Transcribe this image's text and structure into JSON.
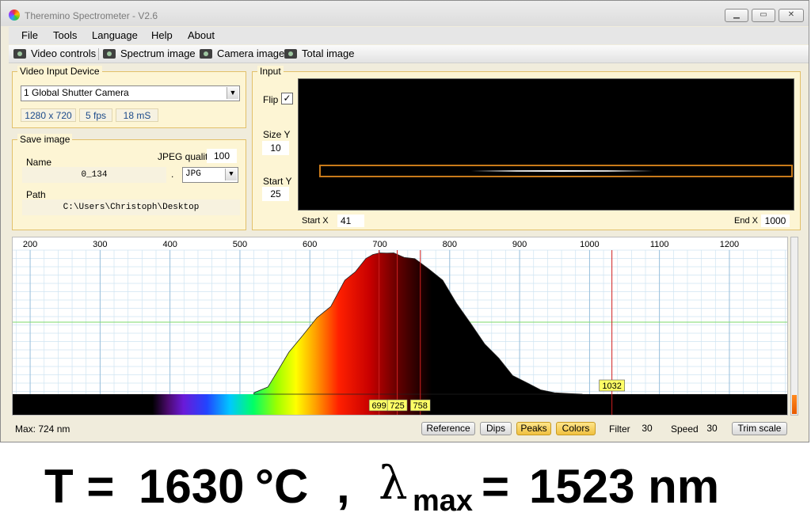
{
  "window": {
    "title": "Theremino Spectrometer - V2.6"
  },
  "menu": [
    "File",
    "Tools",
    "Language",
    "Help",
    "About"
  ],
  "toolbar": {
    "video_controls": "Video controls",
    "spectrum_image": "Spectrum image",
    "camera_image": "Camera image",
    "total_image": "Total image"
  },
  "video_input": {
    "legend": "Video Input Device",
    "device": "1 Global Shutter Camera",
    "resolution": "1280 x 720",
    "fps": "5 fps",
    "exposure": "18 mS"
  },
  "save_image": {
    "legend": "Save image",
    "name_label": "Name",
    "name_value": "0_134",
    "dot": ".",
    "jpeg_quality_label": "JPEG quality",
    "jpeg_quality_value": "100",
    "format": "JPG",
    "path_label": "Path",
    "path_value": "C:\\Users\\Christoph\\Desktop"
  },
  "input": {
    "legend": "Input",
    "flip_label": "Flip",
    "flip_checked": true,
    "size_y_label": "Size Y",
    "size_y_value": "10",
    "start_y_label": "Start Y",
    "start_y_value": "25",
    "start_x_label": "Start X",
    "start_x_value": "41",
    "end_x_label": "End X",
    "end_x_value": "1000"
  },
  "chart_data": {
    "type": "area",
    "xlim": [
      175,
      1285
    ],
    "x_ticks": [
      200,
      300,
      400,
      500,
      600,
      700,
      800,
      900,
      1000,
      1100,
      1200
    ],
    "ylim": [
      0,
      1
    ],
    "series": [
      {
        "x": [
          520,
          540,
          555,
          570,
          590,
          610,
          630,
          650,
          665,
          680,
          690,
          700,
          710,
          720,
          735,
          750,
          770,
          790,
          810,
          830,
          850,
          870,
          890,
          910,
          930,
          950,
          970,
          990
        ],
        "values": [
          0.01,
          0.05,
          0.18,
          0.28,
          0.42,
          0.52,
          0.62,
          0.78,
          0.86,
          0.93,
          0.98,
          0.97,
          0.99,
          0.97,
          0.96,
          0.93,
          0.88,
          0.78,
          0.64,
          0.48,
          0.36,
          0.24,
          0.14,
          0.07,
          0.03,
          0.01,
          0.005,
          0
        ]
      }
    ],
    "peaks": [
      {
        "x": 699,
        "label": "699"
      },
      {
        "x": 725,
        "label": "725"
      },
      {
        "x": 758,
        "label": "758"
      },
      {
        "x": 1032,
        "label": "1032"
      }
    ],
    "grid": true,
    "max_label": "Max: 724 nm"
  },
  "status": {
    "max_text": "Max: 724 nm",
    "reference": "Reference",
    "dips": "Dips",
    "peaks": "Peaks",
    "colors": "Colors",
    "filter_label": "Filter",
    "filter_value": "30",
    "speed_label": "Speed",
    "speed_value": "30",
    "trim_scale": "Trim scale"
  },
  "caption": {
    "t_label": "T =",
    "t_value": "1630",
    "t_unit": "°C",
    "comma": ",",
    "lambda": "λ",
    "lambda_sub": "max",
    "eq": "=",
    "lambda_value": "1523 nm"
  },
  "colors": {
    "panel_border": "#e2c06a",
    "panel_bg": "#fdf5d4",
    "peak_label_bg": "#ffff66",
    "grid": "#a8d0ea"
  }
}
